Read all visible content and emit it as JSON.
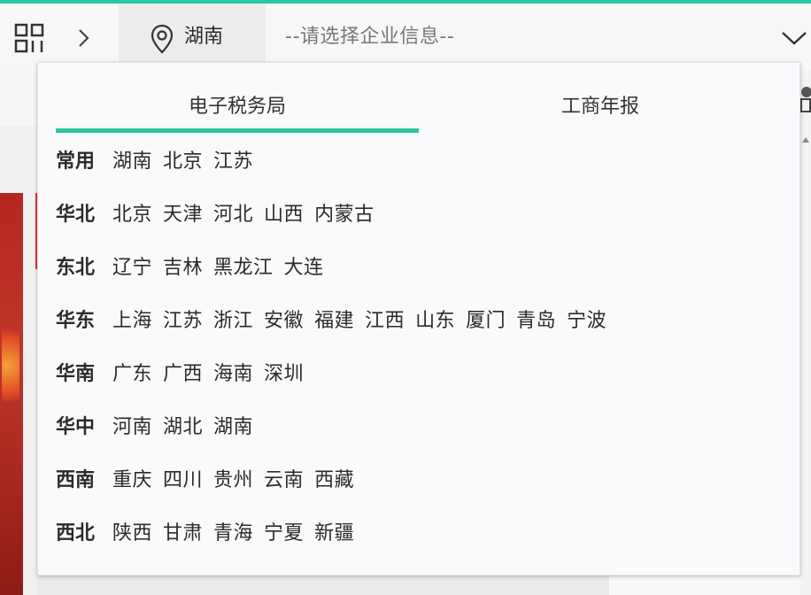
{
  "header": {
    "location": "湖南",
    "placeholder": "--请选择企业信息--"
  },
  "colors": {
    "accent": "#2bc7a3"
  },
  "icons": {
    "apps": "grid-icon",
    "nav": "chevron-right-icon",
    "location": "location-pin-icon",
    "dropdown": "chevron-down-icon"
  },
  "dropdown": {
    "tabs": [
      {
        "label": "电子税务局",
        "active": true
      },
      {
        "label": "工商年报",
        "active": false
      }
    ],
    "regions": [
      {
        "name": "常用",
        "provinces": [
          "湖南",
          "北京",
          "江苏"
        ]
      },
      {
        "name": "华北",
        "provinces": [
          "北京",
          "天津",
          "河北",
          "山西",
          "内蒙古"
        ]
      },
      {
        "name": "东北",
        "provinces": [
          "辽宁",
          "吉林",
          "黑龙江",
          "大连"
        ]
      },
      {
        "name": "华东",
        "provinces": [
          "上海",
          "江苏",
          "浙江",
          "安徽",
          "福建",
          "江西",
          "山东",
          "厦门",
          "青岛",
          "宁波"
        ]
      },
      {
        "name": "华南",
        "provinces": [
          "广东",
          "广西",
          "海南",
          "深圳"
        ]
      },
      {
        "name": "华中",
        "provinces": [
          "河南",
          "湖北",
          "湖南"
        ]
      },
      {
        "name": "西南",
        "provinces": [
          "重庆",
          "四川",
          "贵州",
          "云南",
          "西藏"
        ]
      },
      {
        "name": "西北",
        "provinces": [
          "陕西",
          "甘肃",
          "青海",
          "宁夏",
          "新疆"
        ]
      }
    ]
  }
}
